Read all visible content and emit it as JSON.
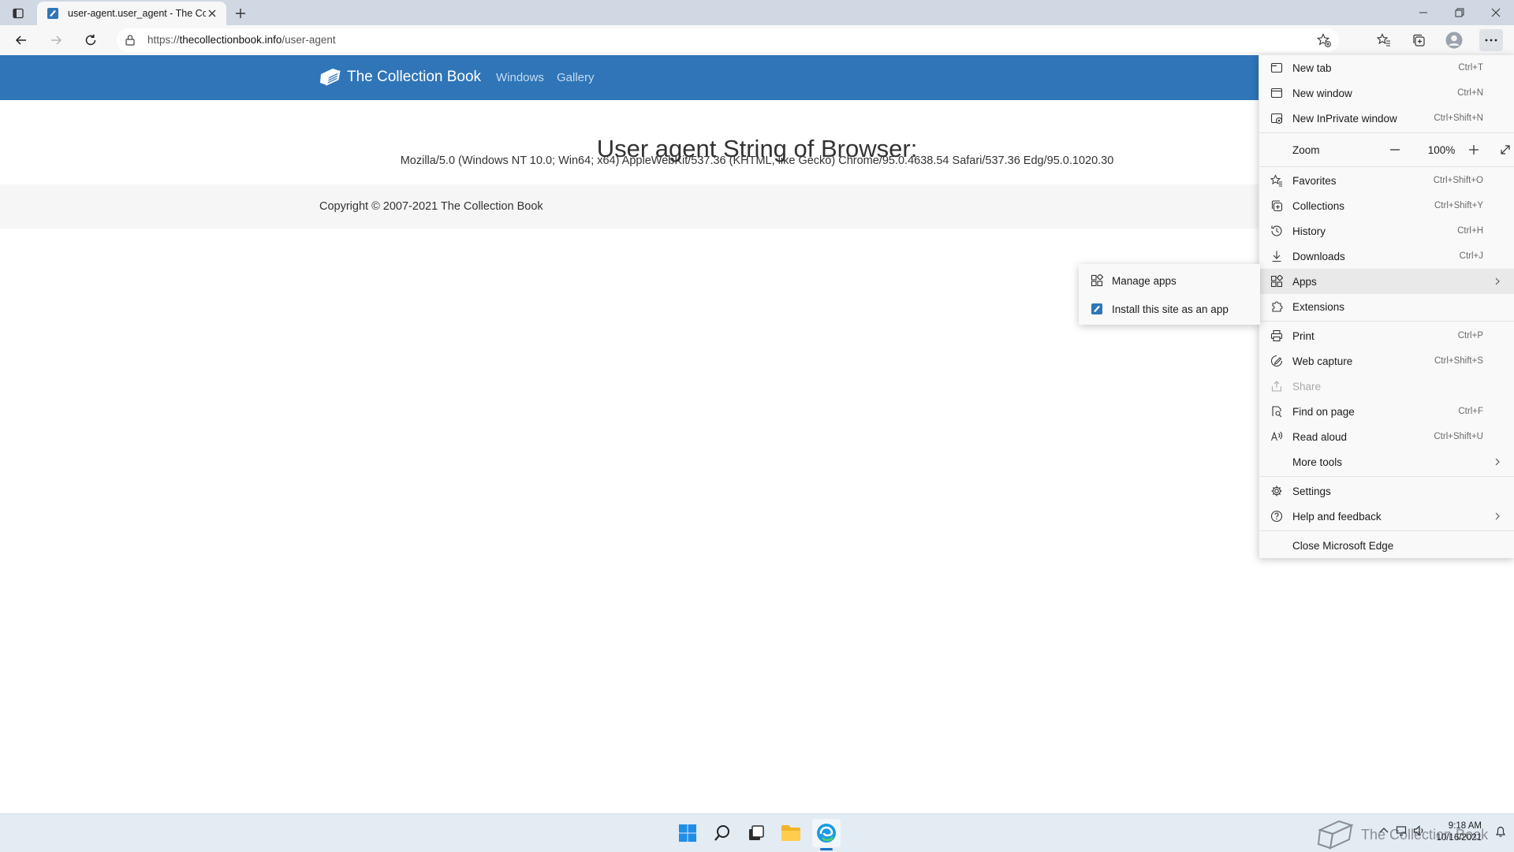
{
  "browser": {
    "tab": {
      "title": "user-agent.user_agent - The Coll"
    },
    "address": {
      "scheme": "https://",
      "host": "thecollectionbook.info",
      "path": "/user-agent"
    }
  },
  "site": {
    "brand": "The Collection Book",
    "nav": [
      "Windows",
      "Gallery"
    ],
    "heading": "User agent String of Browser:",
    "ua_string": "Mozilla/5.0 (Windows NT 10.0; Win64; x64) AppleWebKit/537.36 (KHTML, like Gecko) Chrome/95.0.4638.54 Safari/537.36 Edg/95.0.1020.30",
    "copyright": "Copyright © 2007-2021 The Collection Book"
  },
  "menu": {
    "new_tab": {
      "label": "New tab",
      "shortcut": "Ctrl+T"
    },
    "new_window": {
      "label": "New window",
      "shortcut": "Ctrl+N"
    },
    "new_inprivate": {
      "label": "New InPrivate window",
      "shortcut": "Ctrl+Shift+N"
    },
    "zoom": {
      "label": "Zoom",
      "value": "100%"
    },
    "favorites": {
      "label": "Favorites",
      "shortcut": "Ctrl+Shift+O"
    },
    "collections": {
      "label": "Collections",
      "shortcut": "Ctrl+Shift+Y"
    },
    "history": {
      "label": "History",
      "shortcut": "Ctrl+H"
    },
    "downloads": {
      "label": "Downloads",
      "shortcut": "Ctrl+J"
    },
    "apps": {
      "label": "Apps"
    },
    "extensions": {
      "label": "Extensions"
    },
    "print": {
      "label": "Print",
      "shortcut": "Ctrl+P"
    },
    "web_capture": {
      "label": "Web capture",
      "shortcut": "Ctrl+Shift+S"
    },
    "share": {
      "label": "Share"
    },
    "find": {
      "label": "Find on page",
      "shortcut": "Ctrl+F"
    },
    "read_aloud": {
      "label": "Read aloud",
      "shortcut": "Ctrl+Shift+U"
    },
    "more_tools": {
      "label": "More tools"
    },
    "settings": {
      "label": "Settings"
    },
    "help": {
      "label": "Help and feedback"
    },
    "close_edge": {
      "label": "Close Microsoft Edge"
    }
  },
  "apps_submenu": {
    "manage": "Manage apps",
    "install": "Install this site as an app"
  },
  "taskbar": {
    "watermark": "The Collection Book",
    "time": "9:18 AM",
    "date": "10/16/2021"
  },
  "colors": {
    "site_header": "#2f75b8",
    "tab_strip": "#cfd8e3",
    "menu_bg": "#f9f9f9",
    "taskbar": "#e3ebf3"
  }
}
